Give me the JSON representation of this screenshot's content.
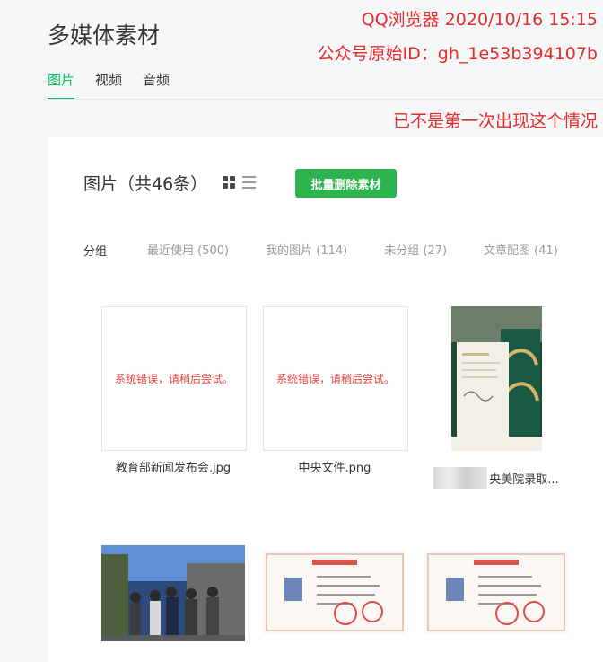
{
  "page": {
    "title": "多媒体素材"
  },
  "annotations": {
    "line1": "QQ浏览器 2020/10/16 15:15",
    "line2": "公众号原始ID：gh_1e53b394107b",
    "line3": "已不是第一次出现这个情况"
  },
  "tabs": [
    {
      "label": "图片",
      "active": true
    },
    {
      "label": "视频",
      "active": false
    },
    {
      "label": "音频",
      "active": false
    }
  ],
  "library": {
    "title": "图片（共46条）",
    "bulk_delete_label": "批量删除素材",
    "groups_label": "分组",
    "groups": [
      "最近使用 (500)",
      "我的图片 (114)",
      "未分组 (27)",
      "文章配图 (41)"
    ]
  },
  "items": [
    {
      "status": "系统错误，请稍后尝试。",
      "name": "教育部新闻发布会.jpg"
    },
    {
      "status": "系统错误，请稍后尝试。",
      "name": "中央文件.png"
    },
    {
      "name": "央美院录取..."
    }
  ],
  "icons": {
    "grid_view": "grid-view-icon",
    "list_view": "list-view-icon"
  },
  "colors": {
    "accent": "#07c160",
    "button": "#2eb34f",
    "error": "#e64340",
    "annotation": "#e62b2b"
  }
}
